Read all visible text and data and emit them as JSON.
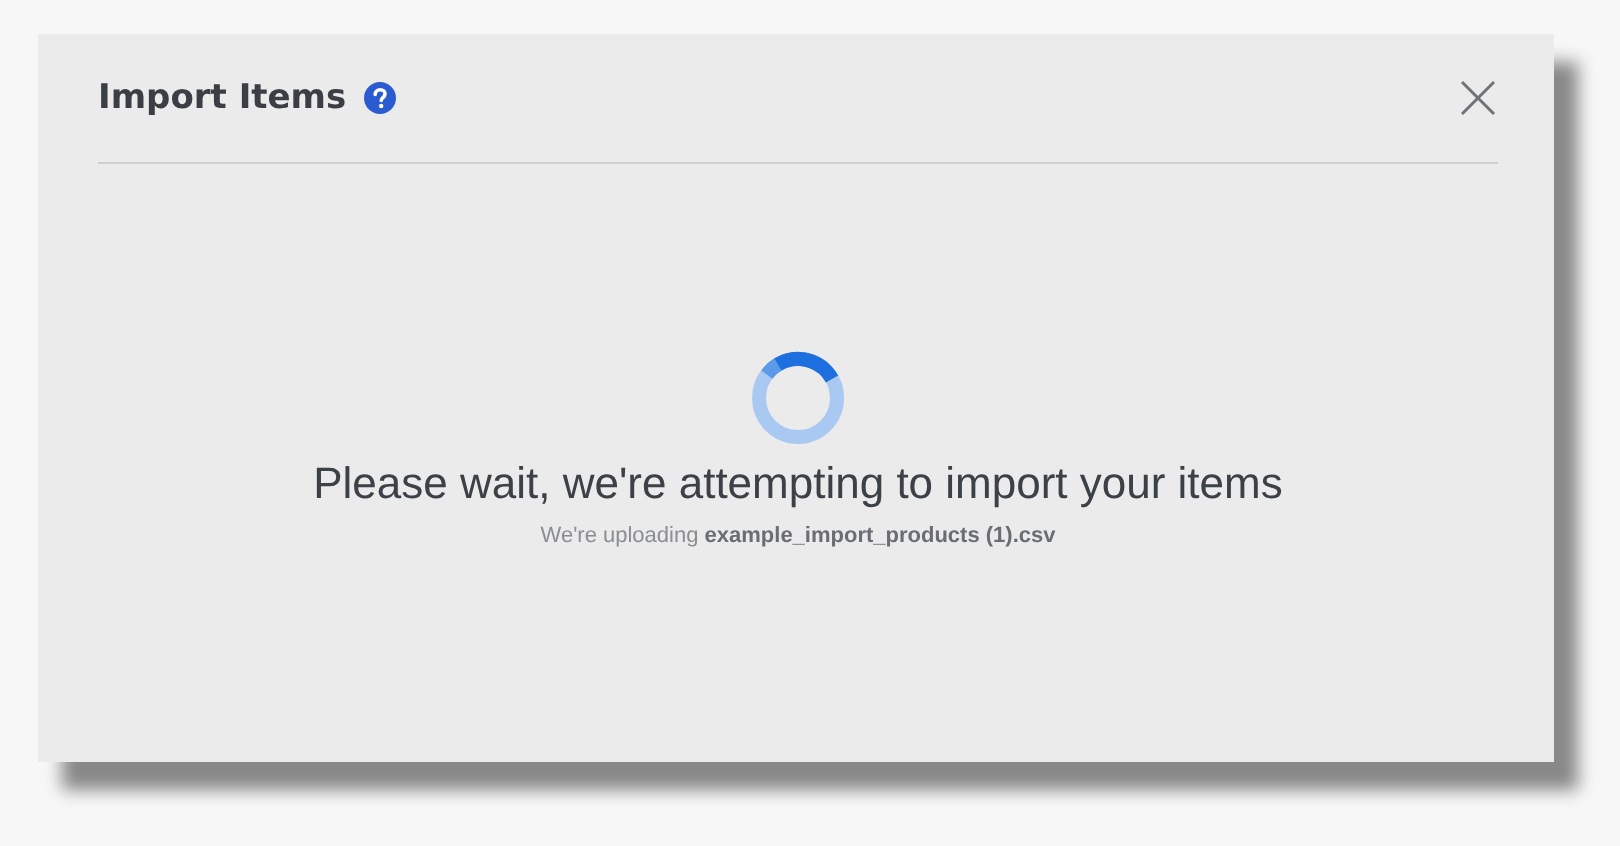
{
  "dialog": {
    "title": "Import Items",
    "status": {
      "heading": "Please wait, we're attempting to import your items",
      "message": "We're uploading **example_import_products (1).csv**"
    }
  }
}
